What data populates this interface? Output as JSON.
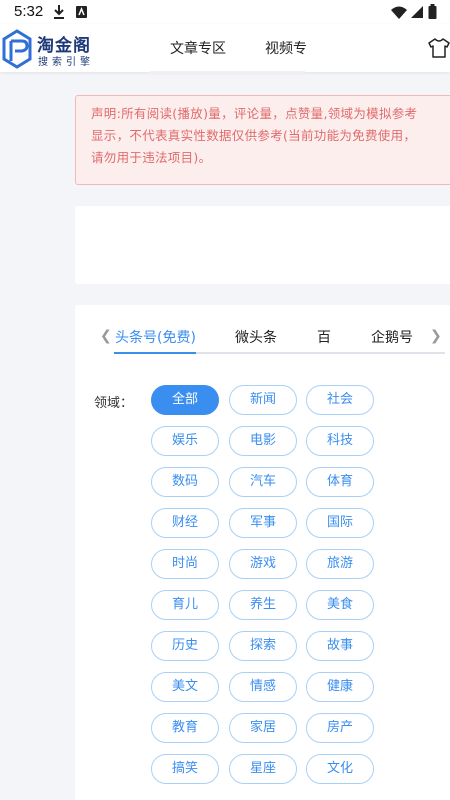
{
  "status_bar": {
    "time": "5:32"
  },
  "header": {
    "logo_title": "淘金阁",
    "logo_subtitle": "搜索引擎",
    "nav_tabs": [
      "文章专区",
      "视频专"
    ]
  },
  "notice": {
    "lines": [
      "声明:所有阅读(播放)量，评论量，点赞量,领域为模拟参考",
      "显示，不代表真实性数据仅供参考(当前功能为免费使用，",
      "请勿用于违法项目)。"
    ]
  },
  "platform_tabs": {
    "items": [
      "头条号(免费)",
      "微头条",
      "百",
      "企鹅号"
    ],
    "active": "头条号(免费)"
  },
  "domain_filter": {
    "label": "领域：",
    "options": [
      "全部",
      "新闻",
      "社会",
      "娱乐",
      "电影",
      "科技",
      "数码",
      "汽车",
      "体育",
      "财经",
      "军事",
      "国际",
      "时尚",
      "游戏",
      "旅游",
      "育儿",
      "养生",
      "美食",
      "历史",
      "探索",
      "故事",
      "美文",
      "情感",
      "健康",
      "教育",
      "家居",
      "房产",
      "搞笑",
      "星座",
      "文化"
    ],
    "selected": "全部"
  },
  "colors": {
    "accent": "#3a8ef0",
    "pill_border": "#a9d1f7",
    "notice_bg": "#fdeeee",
    "notice_text": "#e06b6b",
    "brand": "#1e3a78"
  },
  "icons": [
    "download-icon",
    "app-notification-icon",
    "wifi-icon",
    "signal-icon",
    "battery-icon",
    "logo-icon",
    "shirt-icon",
    "chevron-left-icon",
    "chevron-right-icon"
  ]
}
